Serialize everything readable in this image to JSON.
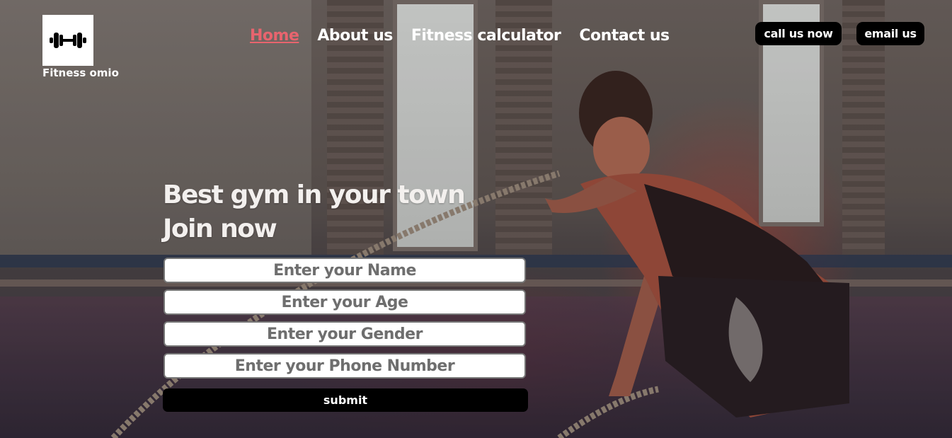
{
  "brand": {
    "name": "Fitness omio",
    "logo_icon": "dumbbell-icon"
  },
  "nav": {
    "items": [
      {
        "label": "Home",
        "active": true
      },
      {
        "label": "About us",
        "active": false
      },
      {
        "label": "Fitness calculator",
        "active": false
      },
      {
        "label": "Contact us",
        "active": false
      }
    ]
  },
  "actions": {
    "call_label": "call us now",
    "email_label": "email us"
  },
  "hero": {
    "line1": "Best gym in your town",
    "line2": "Join now"
  },
  "form": {
    "name_placeholder": "Enter your Name",
    "age_placeholder": "Enter your Age",
    "gender_placeholder": "Enter your Gender",
    "phone_placeholder": "Enter your Phone Number",
    "submit_label": "submit"
  },
  "colors": {
    "active_nav": "#e8646e",
    "button_bg": "#000000",
    "text": "#ffffff"
  }
}
